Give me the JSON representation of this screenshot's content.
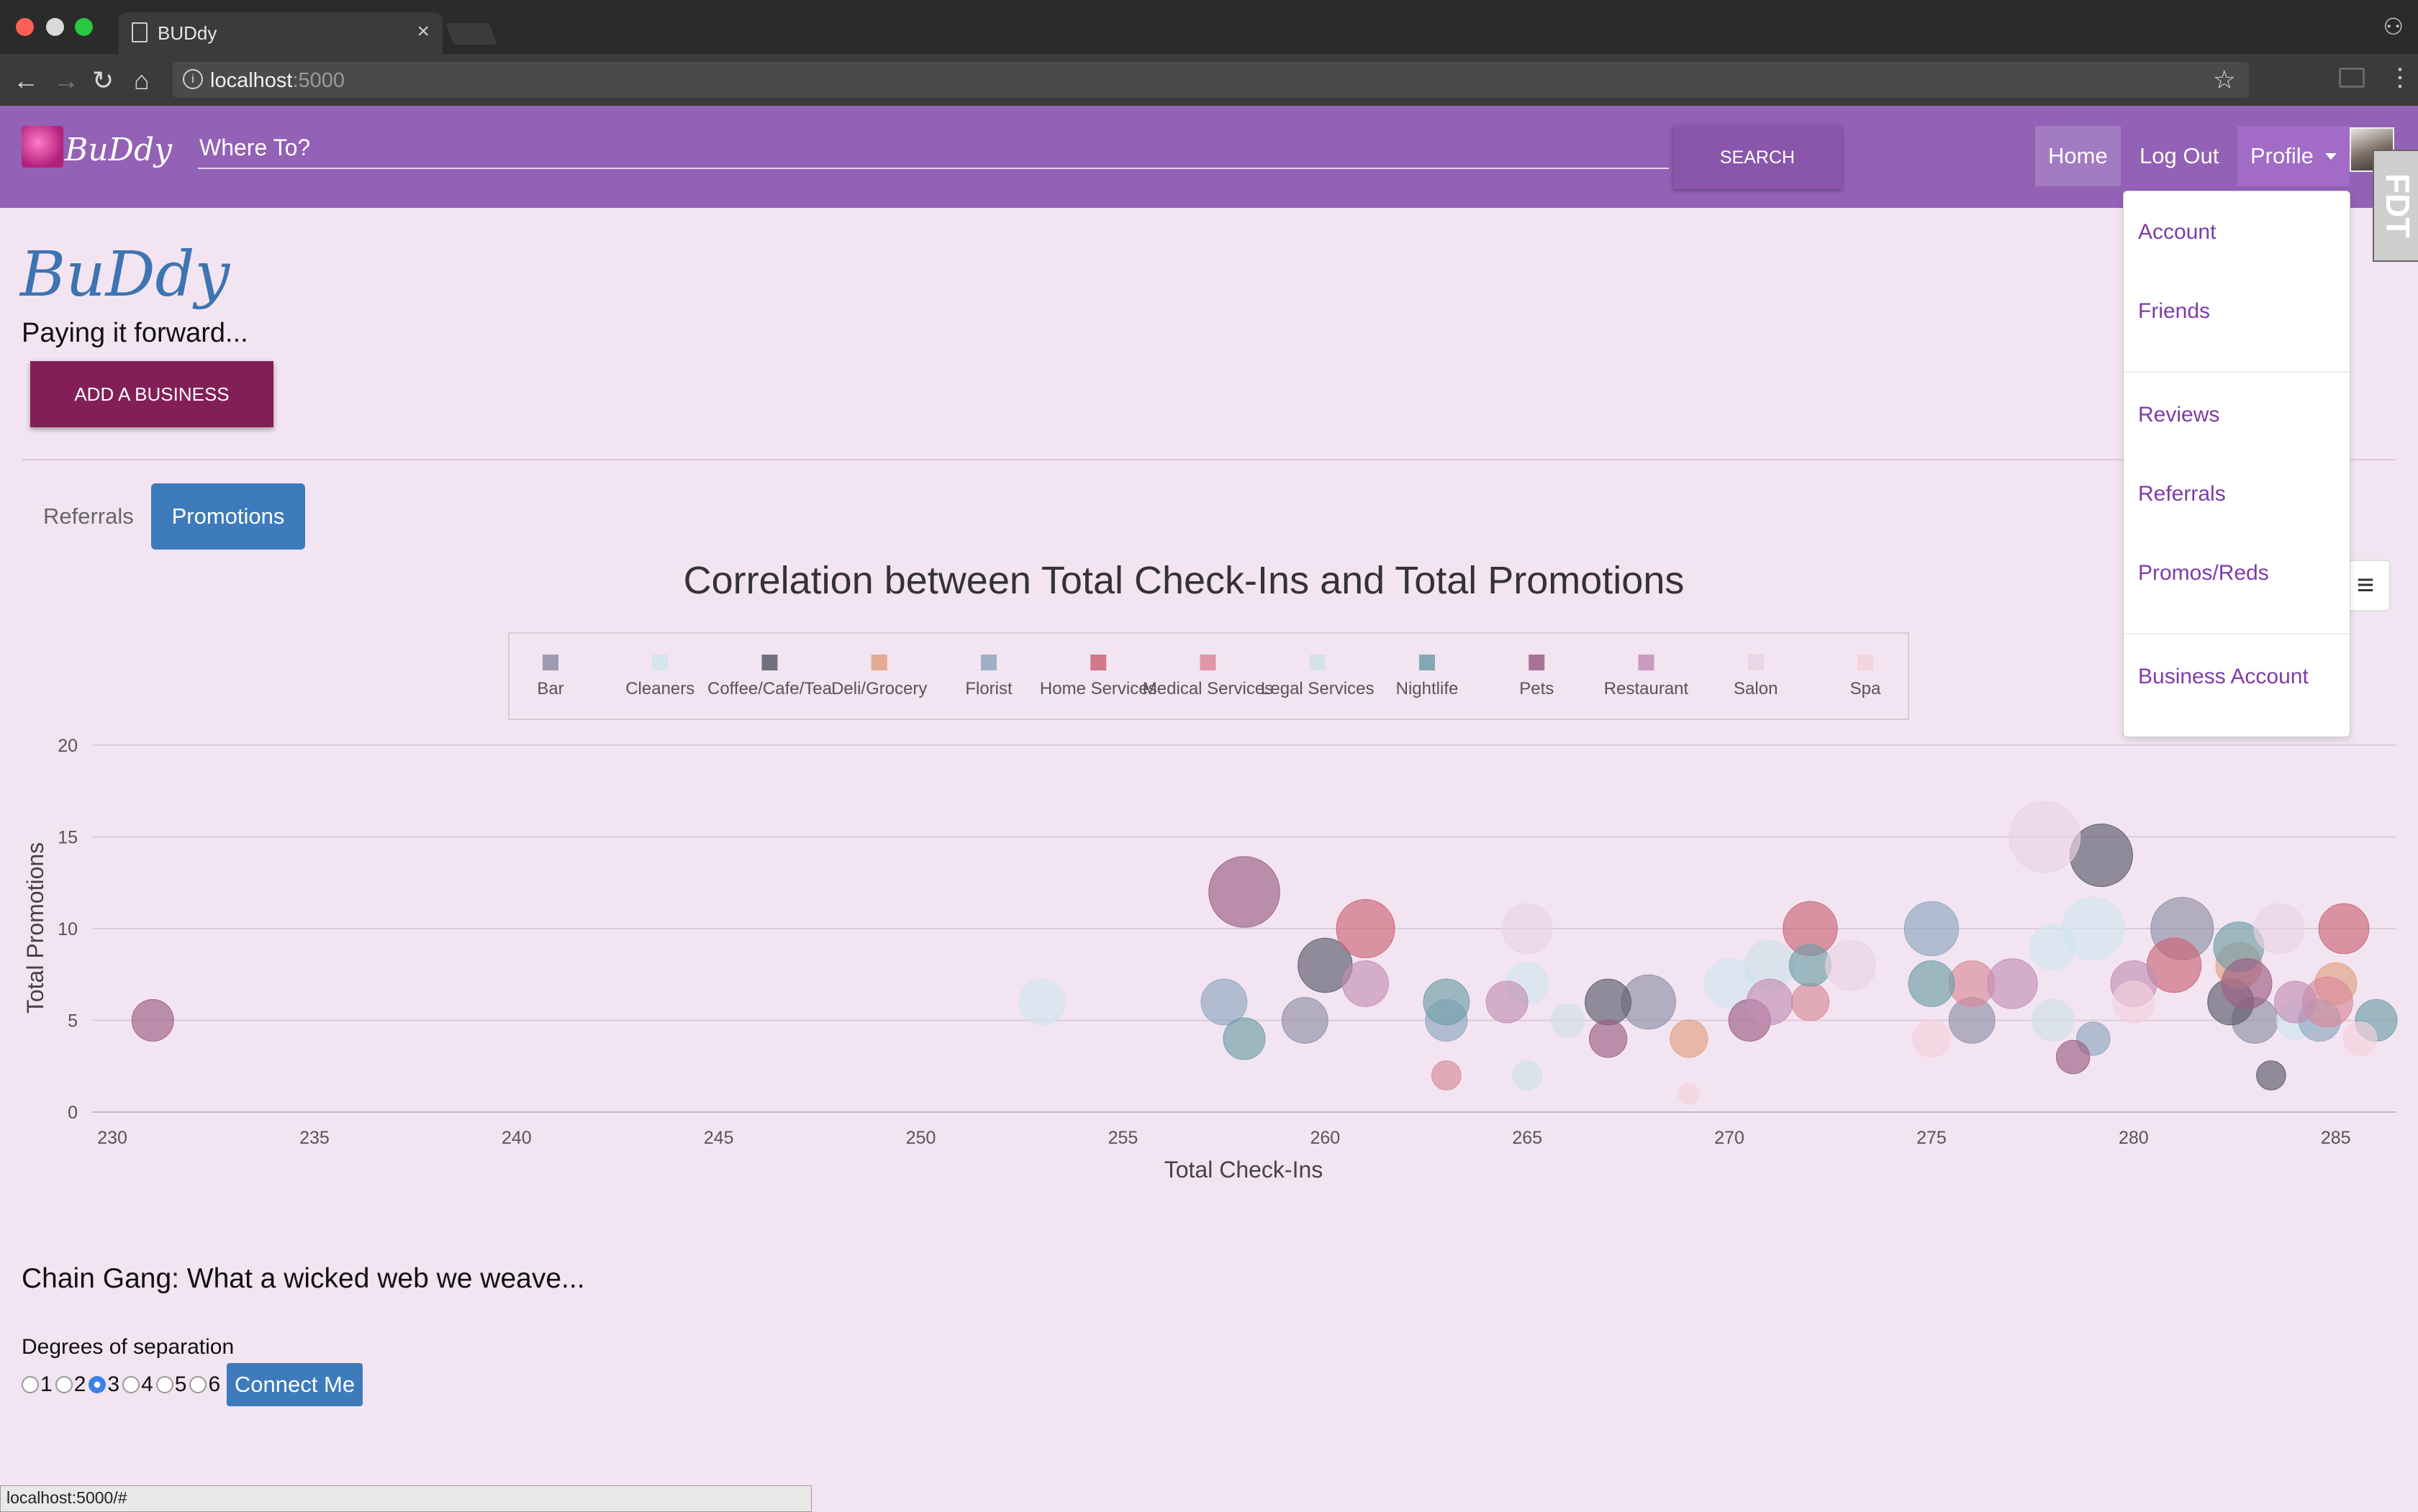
{
  "browser": {
    "tab_title": "BUDdy",
    "url_host": "localhost",
    "url_port": ":5000",
    "status_url": "localhost:5000/#"
  },
  "navbar": {
    "logo_text": "BuDdy",
    "search_placeholder": "Where To?",
    "search_label": "SEARCH",
    "home_label": "Home",
    "logout_label": "Log Out",
    "profile_label": "Profile",
    "badge_text": "FDT"
  },
  "profile_menu": [
    "Account",
    "Friends",
    "Reviews",
    "Referrals",
    "Promos/Reds",
    "Business Account"
  ],
  "page": {
    "brand": "BuDdy",
    "tagline": "Paying it forward...",
    "add_business_label": "ADD A BUSINESS",
    "tabs": [
      {
        "label": "Referrals",
        "active": false
      },
      {
        "label": "Promotions",
        "active": true
      }
    ]
  },
  "chain_gang": {
    "title": "Chain Gang: What a wicked web we weave...",
    "degrees_label": "Degrees of separation",
    "options": [
      "1",
      "2",
      "3",
      "4",
      "5",
      "6"
    ],
    "selected": "3",
    "connect_label": "Connect Me"
  },
  "chart_data": {
    "type": "scatter",
    "title": "Correlation between Total Check-Ins and Total Promotions",
    "xlabel": "Total Check-Ins",
    "ylabel": "Total Promotions",
    "xlim": [
      229.5,
      286.5
    ],
    "ylim": [
      0,
      20
    ],
    "x_ticks": [
      "230",
      "235",
      "240",
      "245",
      "250",
      "255",
      "260",
      "265",
      "270",
      "275",
      "280",
      "285"
    ],
    "y_ticks": [
      "0",
      "5",
      "10",
      "15",
      "20"
    ],
    "grid": true,
    "legend_position": "top",
    "series": [
      {
        "name": "Bar",
        "color": "#8f8fa6",
        "points": [
          [
            259.5,
            5,
            22
          ],
          [
            268,
            6,
            26
          ],
          [
            276,
            5,
            22
          ],
          [
            281.2,
            10,
            30
          ],
          [
            283,
            5,
            22
          ]
        ]
      },
      {
        "name": "Cleaners",
        "color": "#cfe5ef",
        "points": [
          [
            253,
            6,
            22
          ],
          [
            265,
            7,
            20
          ],
          [
            270,
            7,
            24
          ],
          [
            278,
            9,
            22
          ],
          [
            279,
            10,
            30
          ],
          [
            284,
            5,
            18
          ]
        ]
      },
      {
        "name": "Coffee/Cafe/Tea",
        "color": "#5a5a6c",
        "points": [
          [
            260,
            8,
            26
          ],
          [
            267,
            6,
            22
          ],
          [
            279.2,
            14,
            30
          ],
          [
            282.4,
            6,
            22
          ],
          [
            283.4,
            2,
            14
          ]
        ]
      },
      {
        "name": "Deli/Grocery",
        "color": "#e0a082",
        "points": [
          [
            269,
            4,
            18
          ],
          [
            282.6,
            8,
            22
          ],
          [
            285,
            7,
            20
          ]
        ]
      },
      {
        "name": "Florist",
        "color": "#8ea6c0",
        "points": [
          [
            257.5,
            6,
            22
          ],
          [
            263,
            5,
            20
          ],
          [
            275,
            10,
            26
          ],
          [
            279,
            4,
            16
          ],
          [
            284.6,
            5,
            20
          ]
        ]
      },
      {
        "name": "Home Services",
        "color": "#cb6677",
        "points": [
          [
            261,
            10,
            28
          ],
          [
            272,
            10,
            26
          ],
          [
            281,
            8,
            26
          ],
          [
            285.2,
            10,
            24
          ]
        ]
      },
      {
        "name": "Medical Services",
        "color": "#d98a9a",
        "points": [
          [
            263,
            2,
            14
          ],
          [
            272,
            6,
            18
          ],
          [
            276,
            7,
            22
          ],
          [
            284.8,
            6,
            24
          ]
        ]
      },
      {
        "name": "Legal Services",
        "color": "#cfe0ea",
        "points": [
          [
            265,
            2,
            14
          ],
          [
            266,
            5,
            16
          ],
          [
            271,
            8,
            24
          ],
          [
            278,
            5,
            20
          ]
        ]
      },
      {
        "name": "Nightlife",
        "color": "#6e9ea8",
        "points": [
          [
            258,
            4,
            20
          ],
          [
            263,
            6,
            22
          ],
          [
            272,
            8,
            20
          ],
          [
            275,
            7,
            22
          ],
          [
            282.6,
            9,
            24
          ],
          [
            286,
            5,
            20
          ]
        ]
      },
      {
        "name": "Pets",
        "color": "#9b5f86",
        "points": [
          [
            231,
            5,
            20
          ],
          [
            258,
            12,
            34
          ],
          [
            267,
            4,
            18
          ],
          [
            270.5,
            5,
            20
          ],
          [
            278.5,
            3,
            16
          ],
          [
            282.8,
            7,
            24
          ]
        ]
      },
      {
        "name": "Restaurant",
        "color": "#c28fb6",
        "points": [
          [
            261,
            7,
            22
          ],
          [
            264.5,
            6,
            20
          ],
          [
            271,
            6,
            22
          ],
          [
            277,
            7,
            24
          ],
          [
            280,
            7,
            22
          ],
          [
            284,
            6,
            20
          ]
        ]
      },
      {
        "name": "Salon",
        "color": "#ead2e2",
        "points": [
          [
            265,
            10,
            24
          ],
          [
            273,
            8,
            24
          ],
          [
            277.8,
            15,
            34
          ],
          [
            283.6,
            10,
            24
          ]
        ]
      },
      {
        "name": "Spa",
        "color": "#f3d1dc",
        "points": [
          [
            269,
            1,
            10
          ],
          [
            275,
            4,
            18
          ],
          [
            280,
            6,
            20
          ],
          [
            285.6,
            4,
            16
          ]
        ]
      }
    ]
  }
}
